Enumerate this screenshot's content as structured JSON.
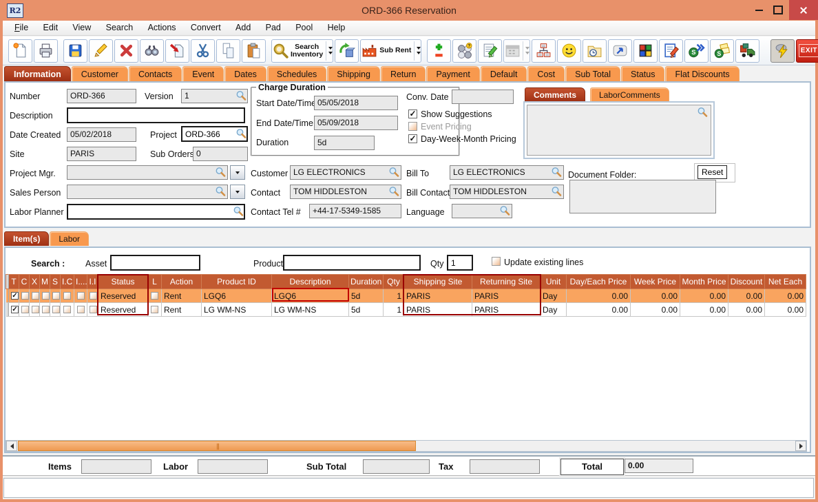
{
  "window": {
    "title": "ORD-366 Reservation",
    "app_badge": "R2"
  },
  "menu": [
    "File",
    "Edit",
    "View",
    "Search",
    "Actions",
    "Convert",
    "Add",
    "Pad",
    "Pool",
    "Help"
  ],
  "toolbar": {
    "search_inventory_line1": "Search",
    "search_inventory_line2": "Inventory",
    "sub_rent": "Sub Rent",
    "exit": "EXIT"
  },
  "tabs": [
    "Information",
    "Customer",
    "Contacts",
    "Event",
    "Dates",
    "Schedules",
    "Shipping",
    "Return",
    "Payment",
    "Default",
    "Cost",
    "Sub Total",
    "Status",
    "Flat Discounts"
  ],
  "info": {
    "number_label": "Number",
    "number": "ORD-366",
    "version_label": "Version",
    "version": "1",
    "description_label": "Description",
    "description": "",
    "date_created_label": "Date Created",
    "date_created": "05/02/2018",
    "project_label": "Project",
    "project": "ORD-366",
    "site_label": "Site",
    "site": "PARIS",
    "sub_orders_label": "Sub Orders",
    "sub_orders": "0",
    "project_mgr_label": "Project Mgr.",
    "project_mgr": "",
    "sales_person_label": "Sales Person",
    "sales_person": "",
    "labor_planner_label": "Labor Planner",
    "labor_planner": "",
    "charge_duration_title": "Charge Duration",
    "start_label": "Start Date/Time",
    "start": "05/05/2018",
    "end_label": "End Date/Time",
    "end": "05/09/2018",
    "duration_label": "Duration",
    "duration": "5d",
    "conv_date_label": "Conv. Date",
    "conv_date": "",
    "show_suggestions_label": "Show Suggestions",
    "event_pricing_label": "Event Pricing",
    "dwm_pricing_label": "Day-Week-Month Pricing",
    "customer_label": "Customer",
    "customer": "LG ELECTRONICS",
    "bill_to_label": "Bill To",
    "bill_to": "LG ELECTRONICS",
    "contact_label": "Contact",
    "contact": "TOM HIDDLESTON",
    "bill_contact_label": "Bill Contact",
    "bill_contact": "TOM HIDDLESTON",
    "contact_tel_label": "Contact Tel #",
    "contact_tel": "+44-17-5349-1585",
    "language_label": "Language",
    "language": "",
    "comments_tab": "Comments",
    "labor_comments_tab": "LaborComments",
    "comments_text": "",
    "document_folder_label": "Document Folder:",
    "reset_label": "Reset",
    "document_folder": ""
  },
  "items": {
    "tab_items": "Item(s)",
    "tab_labor": "Labor",
    "search_label": "Search :",
    "asset_label": "Asset",
    "product_label": "Product",
    "qty_label": "Qty",
    "qty": "1",
    "update_existing_label": "Update existing lines",
    "columns": [
      "T",
      "C",
      "X",
      "M",
      "S",
      "I.C",
      "I....",
      "I.I",
      "Status",
      "L",
      "Action",
      "Product ID",
      "Description",
      "Duration",
      "Qty",
      "Shipping Site",
      "Returning Site",
      "Unit",
      "Day/Each Price",
      "Week Price",
      "Month Price",
      "Discount",
      "Net Each"
    ],
    "rows": [
      {
        "status": "Reserved",
        "action": "Rent",
        "product_id": "LGQ6",
        "description": "LGQ6",
        "duration": "5d",
        "qty": "1",
        "shipping_site": "PARIS",
        "returning_site": "PARIS",
        "unit": "Day",
        "day_each": "0.00",
        "week": "0.00",
        "month": "0.00",
        "discount": "0.00",
        "net_each": "0.00"
      },
      {
        "status": "Reserved",
        "action": "Rent",
        "product_id": "LG WM-NS",
        "description": "LG WM-NS",
        "duration": "5d",
        "qty": "1",
        "shipping_site": "PARIS",
        "returning_site": "PARIS",
        "unit": "Day",
        "day_each": "0.00",
        "week": "0.00",
        "month": "0.00",
        "discount": "0.00",
        "net_each": "0.00"
      }
    ]
  },
  "footer": {
    "items_label": "Items",
    "labor_label": "Labor",
    "sub_total_label": "Sub Total",
    "tax_label": "Tax",
    "total_label": "Total",
    "total": "0.00"
  },
  "colors": {
    "titlebar": "#e8916a",
    "tab_active": "#a63918",
    "tab_inactive": "#f8994e",
    "table_header": "#c25a31",
    "row_selected": "#f9a45f",
    "highlight": "#990000",
    "close_button": "#c84a48"
  }
}
